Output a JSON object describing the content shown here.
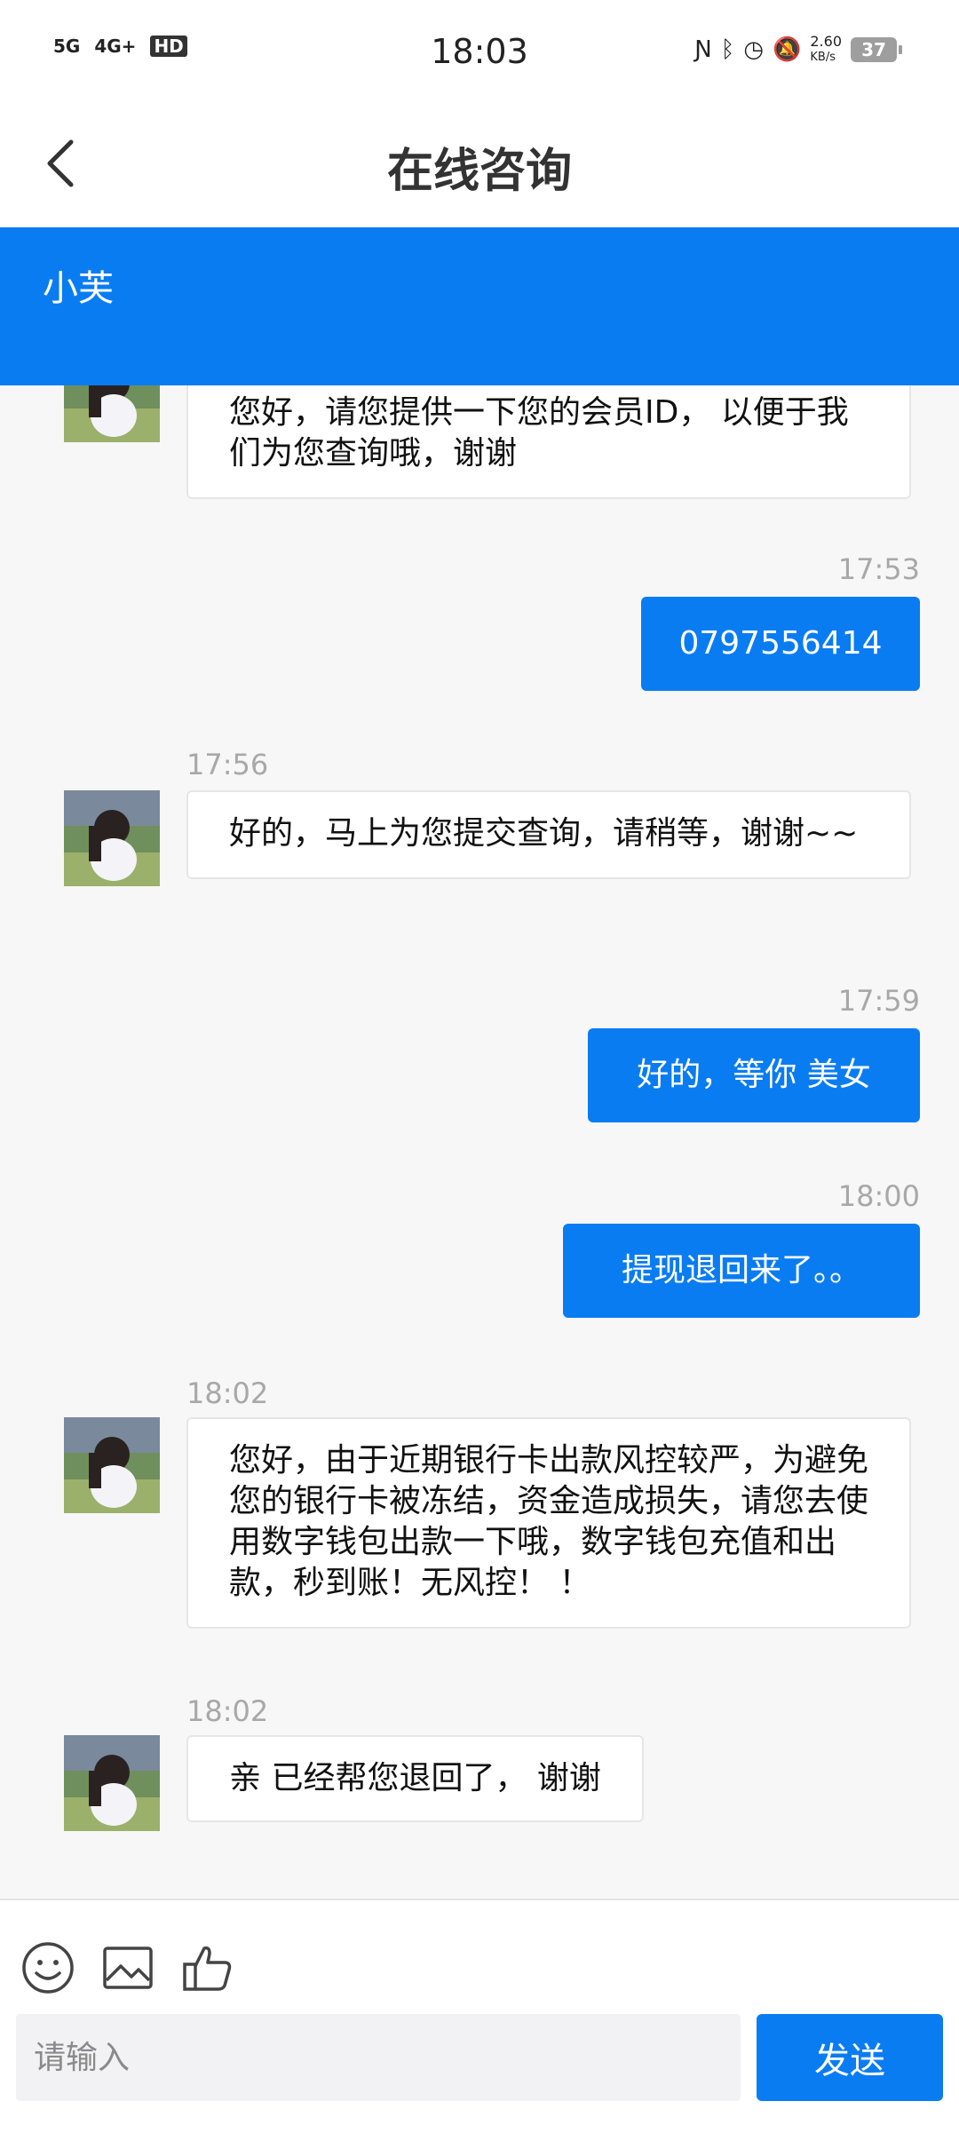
{
  "status_bar": {
    "net1": "5G",
    "net2": "4G+",
    "hd": "HD",
    "time": "18:03",
    "speed_value": "2.60",
    "speed_unit": "KB/s",
    "battery": "37"
  },
  "header": {
    "title": "在线咨询"
  },
  "agent": {
    "name": "小芙"
  },
  "messages": [
    {
      "side": "in",
      "time": "",
      "text": "您好，请您提供一下您的会员ID， 以便于我们为您查询哦，谢谢"
    },
    {
      "side": "out",
      "time": "17:53",
      "text": "0797556414"
    },
    {
      "side": "in",
      "time": "17:56",
      "text": "好的，马上为您提交查询，请稍等，谢谢~~"
    },
    {
      "side": "out",
      "time": "17:59",
      "text": "好的，等你 美女"
    },
    {
      "side": "out",
      "time": "18:00",
      "text": "提现退回来了。。"
    },
    {
      "side": "in",
      "time": "18:02",
      "text": "您好，由于近期银行卡出款风控较严，为避免您的银行卡被冻结，资金造成损失，请您去使用数字钱包出款一下哦，数字钱包充值和出款，秒到账！无风控！ ！"
    },
    {
      "side": "in",
      "time": "18:02",
      "text": "亲 已经帮您退回了， 谢谢"
    }
  ],
  "composer": {
    "placeholder": "请输入",
    "send_label": "发送",
    "tools": [
      "emoji-icon",
      "image-icon",
      "thumbs-up-icon"
    ]
  },
  "colors": {
    "accent": "#0a7cf2",
    "bubble_in": "#ffffff",
    "background": "#f7f7f7"
  }
}
